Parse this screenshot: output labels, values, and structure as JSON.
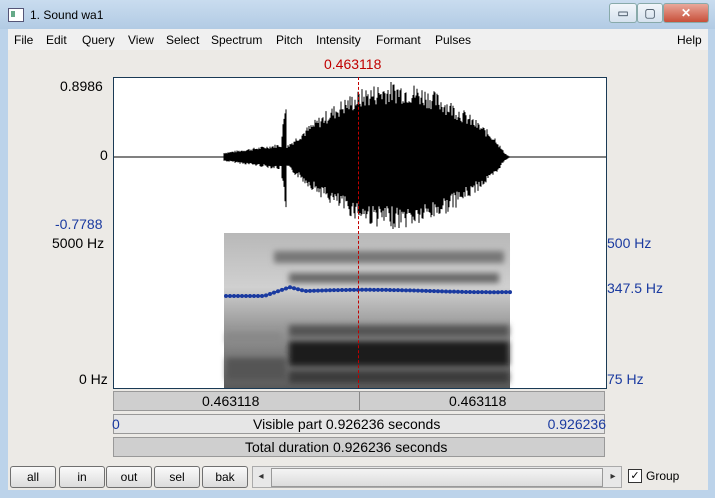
{
  "window": {
    "title": "1. Sound wa1",
    "controls": {
      "minimize": "▭",
      "maximize": "▢",
      "close": "✕"
    }
  },
  "menu": [
    "File",
    "Edit",
    "Query",
    "View",
    "Select",
    "Spectrum",
    "Pitch",
    "Intensity",
    "Formant",
    "Pulses"
  ],
  "help": "Help",
  "cursor": {
    "time": "0.463118"
  },
  "waveform": {
    "max_label": "0.8986",
    "zero_label": "0",
    "min_label": "-0.7788"
  },
  "spectrogram": {
    "top_freq": "5000 Hz",
    "bottom_freq": "0 Hz"
  },
  "pitch": {
    "top": "500 Hz",
    "mid": "347.5 Hz",
    "bottom": "75 Hz"
  },
  "info": {
    "left_time": "0.463118",
    "right_time": "0.463118",
    "visible_start": "0",
    "visible_text": "Visible part 0.926236 seconds",
    "visible_end": "0.926236",
    "total_text": "Total duration 0.926236 seconds"
  },
  "buttons": {
    "all": "all",
    "in": "in",
    "out": "out",
    "sel": "sel",
    "bak": "bak"
  },
  "scrollbar": {
    "left_arrow": "◂",
    "right_arrow": "▸"
  },
  "group": {
    "checked": "✓",
    "label": "Group"
  },
  "colors": {
    "cursor": "#c00000",
    "pitch": "#1a3aa0",
    "frame": "#1a3a55"
  }
}
